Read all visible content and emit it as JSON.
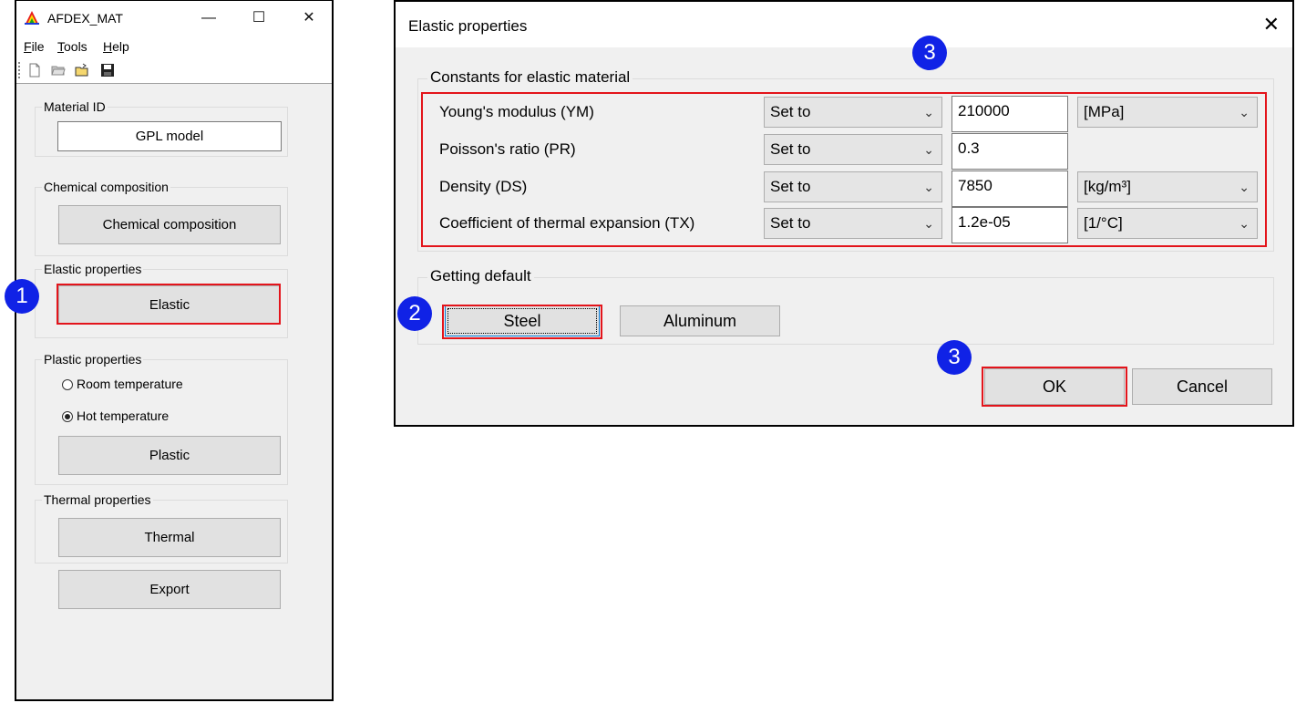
{
  "main_window": {
    "title": "AFDEX_MAT",
    "controls": {
      "minimize": "—",
      "maximize": "☐",
      "close": "✕"
    },
    "menu": [
      {
        "accel": "F",
        "rest": "ile"
      },
      {
        "accel": "T",
        "rest": "ools"
      },
      {
        "accel": "H",
        "rest": "elp"
      }
    ],
    "toolbar_icons": [
      "new-file-icon",
      "open-folder-icon",
      "open-recent-icon",
      "save-icon"
    ],
    "material_id": {
      "label": "Material ID",
      "value": "GPL model"
    },
    "chemical": {
      "label": "Chemical composition",
      "button": "Chemical composition"
    },
    "elastic": {
      "label": "Elastic properties",
      "button": "Elastic"
    },
    "plastic": {
      "label": "Plastic properties",
      "options": [
        {
          "label": "Room temperature",
          "selected": false
        },
        {
          "label": "Hot temperature",
          "selected": true
        }
      ],
      "button": "Plastic"
    },
    "thermal": {
      "label": "Thermal properties",
      "button": "Thermal"
    },
    "export_button": "Export"
  },
  "dialog": {
    "title": "Elastic properties",
    "close": "✕",
    "constants_group": "Constants for elastic material",
    "properties": [
      {
        "label": "Young's modulus (YM)",
        "mode": "Set to",
        "value": "210000",
        "unit": "[MPa]"
      },
      {
        "label": "Poisson's ratio (PR)",
        "mode": "Set to",
        "value": "0.3",
        "unit": ""
      },
      {
        "label": "Density (DS)",
        "mode": "Set to",
        "value": "7850",
        "unit": "[kg/m³]"
      },
      {
        "label": "Coefficient of thermal expansion (TX)",
        "mode": "Set to",
        "value": "1.2e-05",
        "unit": "[1/°C]"
      }
    ],
    "defaults_group": "Getting default",
    "steel_button": "Steel",
    "aluminum_button": "Aluminum",
    "ok_button": "OK",
    "cancel_button": "Cancel"
  },
  "annotations": {
    "badge1": "1",
    "badge2": "2",
    "badge3a": "3",
    "badge3b": "3"
  },
  "colors": {
    "highlight": "#e3141b",
    "badge": "#1022e6",
    "window_bg": "#f0f0f0"
  }
}
